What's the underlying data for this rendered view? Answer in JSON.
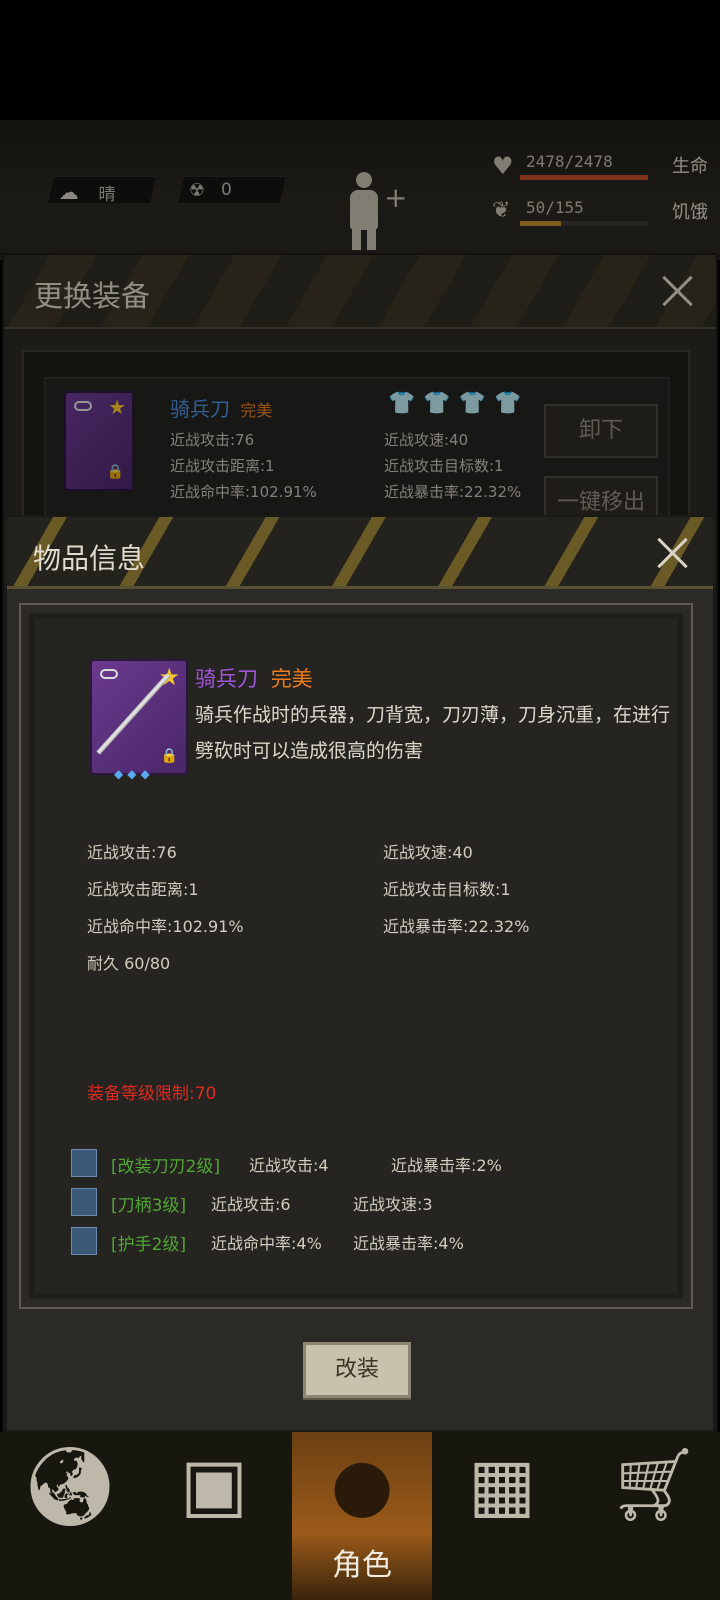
{
  "hud": {
    "weather": "晴",
    "radiation": "0",
    "health": {
      "value": "2478/2478",
      "label": "生命",
      "ratio": 1.0
    },
    "hunger": {
      "value": "50/155",
      "label": "饥饿",
      "ratio": 0.32
    }
  },
  "equip_panel": {
    "title": "更换装备",
    "item": {
      "name": "骑兵刀",
      "quality": "完美",
      "stats": [
        "近战攻击:76",
        "近战攻速:40",
        "近战攻击距离:1",
        "近战攻击目标数:1",
        "近战命中率:102.91%",
        "近战暴击率:22.32%"
      ]
    },
    "unequip_label": "卸下",
    "remove_all_label": "一键移出"
  },
  "item_info": {
    "title": "物品信息",
    "name": "骑兵刀",
    "quality": "完美",
    "description": "骑兵作战时的兵器，刀背宽，刀刃薄，刀身沉重，在进行劈砍时可以造成很高的伤害",
    "stats": {
      "attack": "近战攻击:76",
      "speed": "近战攻速:40",
      "range": "近战攻击距离:1",
      "targets": "近战攻击目标数:1",
      "hit": "近战命中率:102.91%",
      "crit": "近战暴击率:22.32%",
      "durability": "耐久 60/80"
    },
    "level_req": "装备等级限制:70",
    "mods": [
      {
        "name": "[改装刀刃2级]",
        "val1": "近战攻击:4",
        "val2": "近战暴击率:2%"
      },
      {
        "name": "[刀柄3级]",
        "val1": "近战攻击:6",
        "val2": "近战攻速:3"
      },
      {
        "name": "[护手2级]",
        "val1": "近战命中率:4%",
        "val2": "近战暴击率:4%"
      }
    ],
    "modify_label": "改装"
  },
  "nav": {
    "active_label": "角色"
  },
  "colors": {
    "purple_name": "#a056d8",
    "quality_orange": "#f07b1a",
    "req_red": "#e02a1e",
    "mod_green": "#4fa832"
  }
}
